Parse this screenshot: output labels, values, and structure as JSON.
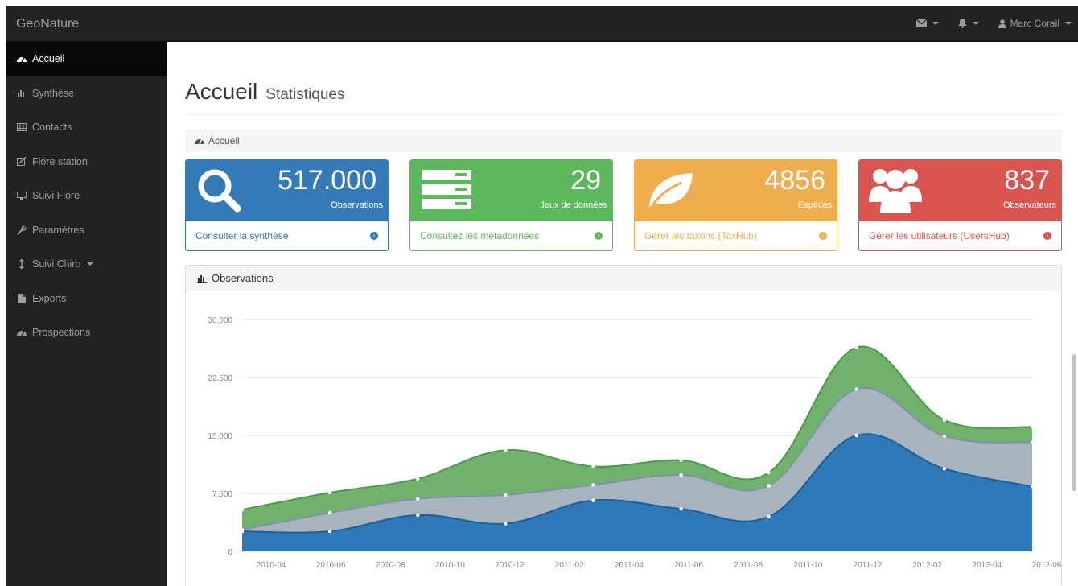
{
  "app": {
    "brand": "GeoNature"
  },
  "topnav": {
    "user_name": "Marc Corail",
    "mail_icon": "envelope-icon",
    "bell_icon": "bell-icon",
    "user_icon": "user-icon"
  },
  "sidebar": {
    "items": [
      {
        "label": "Accueil",
        "icon": "dashboard-icon",
        "active": true
      },
      {
        "label": "Synthèse",
        "icon": "bar-chart-icon"
      },
      {
        "label": "Contacts",
        "icon": "table-icon"
      },
      {
        "label": "Flore station",
        "icon": "edit-icon"
      },
      {
        "label": "Suivi Flore",
        "icon": "desktop-icon"
      },
      {
        "label": "Paramètres",
        "icon": "wrench-icon"
      },
      {
        "label": "Suivi Chiro",
        "icon": "resize-vertical-icon"
      },
      {
        "label": "Exports",
        "icon": "file-icon"
      },
      {
        "label": "Prospections",
        "icon": "dashboard-icon"
      }
    ]
  },
  "header": {
    "title": "Accueil",
    "subtitle": "Statistiques"
  },
  "breadcrumb": {
    "label": "Accueil"
  },
  "cards": [
    {
      "value": "517.000",
      "label": "Observations",
      "link": "Consulter la synthèse",
      "icon": "search-icon",
      "color": "#337ab7"
    },
    {
      "value": "29",
      "label": "Jeux de données",
      "link": "Consultez les métadonnées",
      "icon": "server-icon",
      "color": "#5cb85c"
    },
    {
      "value": "4856",
      "label": "Espèces",
      "link": "Gérer les taxons (TaxHub)",
      "icon": "leaf-icon",
      "color": "#f0ad4e"
    },
    {
      "value": "837",
      "label": "Observateurs",
      "link": "Gérer les utilisateurs (UsersHub)",
      "icon": "users-icon",
      "color": "#d9534f"
    }
  ],
  "panel": {
    "title": "Observations"
  },
  "chart_data": {
    "type": "area",
    "stacked": true,
    "x": [
      "2010-03",
      "2010-06",
      "2010-09",
      "2010-12",
      "2011-03",
      "2011-06",
      "2011-09",
      "2011-12",
      "2012-03",
      "2012-06"
    ],
    "x_tick_labels": [
      "2010-04",
      "2010-06",
      "2010-08",
      "2010-10",
      "2010-12",
      "2011-02",
      "2011-04",
      "2011-06",
      "2011-08",
      "2011-10",
      "2011-12",
      "2012-02",
      "2012-04",
      "2012-06"
    ],
    "series": [
      {
        "values": [
          2600,
          2600,
          4700,
          3600,
          6600,
          5500,
          4500,
          15000,
          10700,
          8400
        ],
        "color": "#2f79b9"
      },
      {
        "values": [
          200,
          2400,
          2100,
          3700,
          2000,
          4400,
          4000,
          6000,
          4200,
          5700
        ],
        "color": "#a7b4c0"
      },
      {
        "values": [
          2600,
          2600,
          2600,
          5800,
          2400,
          1900,
          1700,
          5400,
          2100,
          2000
        ],
        "color": "#71b16e"
      }
    ],
    "y_ticks": [
      "0",
      "7,500",
      "15,000",
      "22,500",
      "30,000"
    ],
    "ylim": [
      0,
      30000
    ],
    "grid": true
  }
}
